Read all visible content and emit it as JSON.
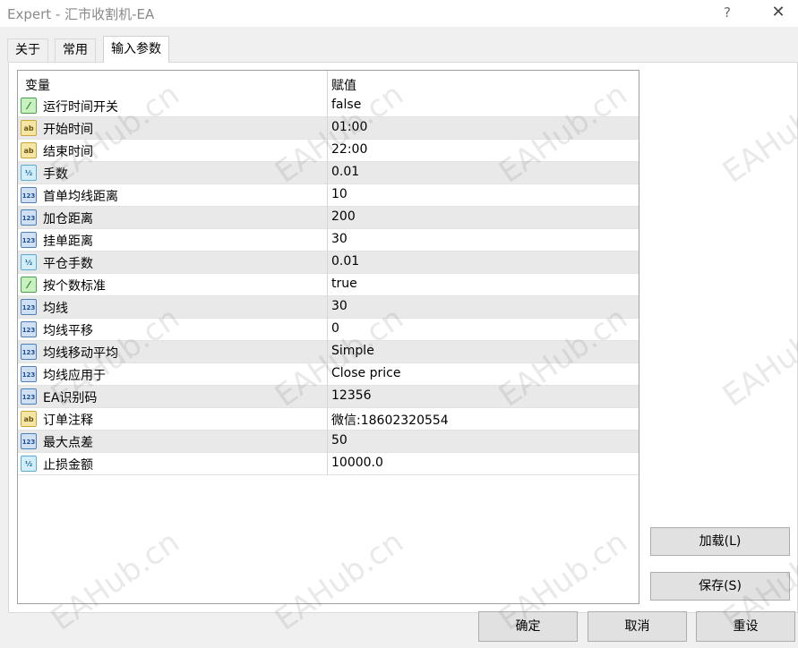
{
  "window": {
    "title": "Expert - 汇市收割机-EA",
    "help_label": "?",
    "close_label": "✕"
  },
  "tabs": [
    {
      "label": "关于"
    },
    {
      "label": "常用"
    },
    {
      "label": "输入参数",
      "active": true
    }
  ],
  "grid": {
    "headers": {
      "variable": "变量",
      "value": "赋值"
    },
    "rows": [
      {
        "icon": "bool",
        "name": "运行时间开关",
        "value": "false"
      },
      {
        "icon": "string",
        "name": "开始时间",
        "value": "01:00"
      },
      {
        "icon": "string",
        "name": "结束时间",
        "value": "22:00"
      },
      {
        "icon": "double",
        "name": "手数",
        "value": "0.01"
      },
      {
        "icon": "int",
        "name": "首单均线距离",
        "value": "10"
      },
      {
        "icon": "int",
        "name": "加仓距离",
        "value": "200"
      },
      {
        "icon": "int",
        "name": "挂单距离",
        "value": "30"
      },
      {
        "icon": "double",
        "name": "平仓手数",
        "value": "0.01"
      },
      {
        "icon": "bool",
        "name": "按个数标准",
        "value": "true"
      },
      {
        "icon": "int",
        "name": "均线",
        "value": "30"
      },
      {
        "icon": "int",
        "name": "均线平移",
        "value": "0"
      },
      {
        "icon": "int",
        "name": "均线移动平均",
        "value": "Simple"
      },
      {
        "icon": "int",
        "name": "均线应用于",
        "value": "Close price"
      },
      {
        "icon": "int",
        "name": "EA识别码",
        "value": "12356"
      },
      {
        "icon": "string",
        "name": "订单注释",
        "value": "微信:18602320554"
      },
      {
        "icon": "int",
        "name": "最大点差",
        "value": "50"
      },
      {
        "icon": "double",
        "name": "止损金额",
        "value": "10000.0"
      }
    ]
  },
  "icon_glyphs": {
    "bool": "⁄",
    "string": "ab",
    "double": "½",
    "int": "123"
  },
  "side_buttons": {
    "load": "加载(L)",
    "save": "保存(S)"
  },
  "bottom_buttons": {
    "ok": "确定",
    "cancel": "取消",
    "reset": "重设"
  },
  "watermark": {
    "text": "EAHub.cn"
  }
}
